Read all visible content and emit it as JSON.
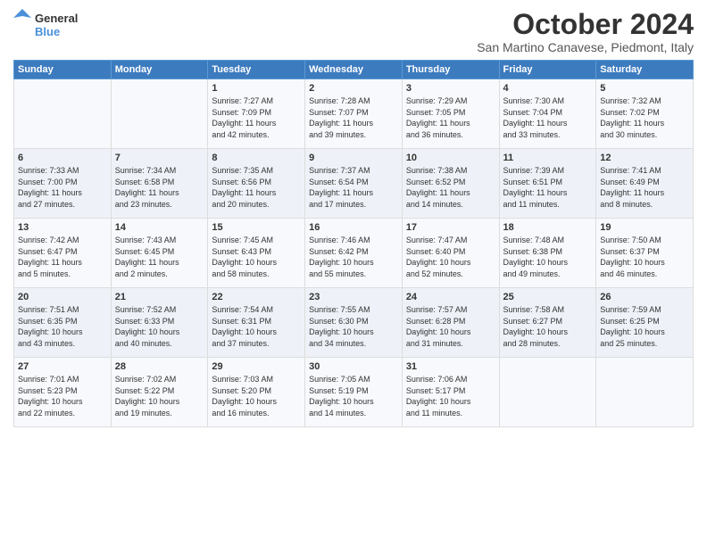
{
  "header": {
    "logo_line1": "General",
    "logo_line2": "Blue",
    "month": "October 2024",
    "location": "San Martino Canavese, Piedmont, Italy"
  },
  "days_of_week": [
    "Sunday",
    "Monday",
    "Tuesday",
    "Wednesday",
    "Thursday",
    "Friday",
    "Saturday"
  ],
  "weeks": [
    [
      {
        "day": "",
        "content": ""
      },
      {
        "day": "",
        "content": ""
      },
      {
        "day": "1",
        "content": "Sunrise: 7:27 AM\nSunset: 7:09 PM\nDaylight: 11 hours\nand 42 minutes."
      },
      {
        "day": "2",
        "content": "Sunrise: 7:28 AM\nSunset: 7:07 PM\nDaylight: 11 hours\nand 39 minutes."
      },
      {
        "day": "3",
        "content": "Sunrise: 7:29 AM\nSunset: 7:05 PM\nDaylight: 11 hours\nand 36 minutes."
      },
      {
        "day": "4",
        "content": "Sunrise: 7:30 AM\nSunset: 7:04 PM\nDaylight: 11 hours\nand 33 minutes."
      },
      {
        "day": "5",
        "content": "Sunrise: 7:32 AM\nSunset: 7:02 PM\nDaylight: 11 hours\nand 30 minutes."
      }
    ],
    [
      {
        "day": "6",
        "content": "Sunrise: 7:33 AM\nSunset: 7:00 PM\nDaylight: 11 hours\nand 27 minutes."
      },
      {
        "day": "7",
        "content": "Sunrise: 7:34 AM\nSunset: 6:58 PM\nDaylight: 11 hours\nand 23 minutes."
      },
      {
        "day": "8",
        "content": "Sunrise: 7:35 AM\nSunset: 6:56 PM\nDaylight: 11 hours\nand 20 minutes."
      },
      {
        "day": "9",
        "content": "Sunrise: 7:37 AM\nSunset: 6:54 PM\nDaylight: 11 hours\nand 17 minutes."
      },
      {
        "day": "10",
        "content": "Sunrise: 7:38 AM\nSunset: 6:52 PM\nDaylight: 11 hours\nand 14 minutes."
      },
      {
        "day": "11",
        "content": "Sunrise: 7:39 AM\nSunset: 6:51 PM\nDaylight: 11 hours\nand 11 minutes."
      },
      {
        "day": "12",
        "content": "Sunrise: 7:41 AM\nSunset: 6:49 PM\nDaylight: 11 hours\nand 8 minutes."
      }
    ],
    [
      {
        "day": "13",
        "content": "Sunrise: 7:42 AM\nSunset: 6:47 PM\nDaylight: 11 hours\nand 5 minutes."
      },
      {
        "day": "14",
        "content": "Sunrise: 7:43 AM\nSunset: 6:45 PM\nDaylight: 11 hours\nand 2 minutes."
      },
      {
        "day": "15",
        "content": "Sunrise: 7:45 AM\nSunset: 6:43 PM\nDaylight: 10 hours\nand 58 minutes."
      },
      {
        "day": "16",
        "content": "Sunrise: 7:46 AM\nSunset: 6:42 PM\nDaylight: 10 hours\nand 55 minutes."
      },
      {
        "day": "17",
        "content": "Sunrise: 7:47 AM\nSunset: 6:40 PM\nDaylight: 10 hours\nand 52 minutes."
      },
      {
        "day": "18",
        "content": "Sunrise: 7:48 AM\nSunset: 6:38 PM\nDaylight: 10 hours\nand 49 minutes."
      },
      {
        "day": "19",
        "content": "Sunrise: 7:50 AM\nSunset: 6:37 PM\nDaylight: 10 hours\nand 46 minutes."
      }
    ],
    [
      {
        "day": "20",
        "content": "Sunrise: 7:51 AM\nSunset: 6:35 PM\nDaylight: 10 hours\nand 43 minutes."
      },
      {
        "day": "21",
        "content": "Sunrise: 7:52 AM\nSunset: 6:33 PM\nDaylight: 10 hours\nand 40 minutes."
      },
      {
        "day": "22",
        "content": "Sunrise: 7:54 AM\nSunset: 6:31 PM\nDaylight: 10 hours\nand 37 minutes."
      },
      {
        "day": "23",
        "content": "Sunrise: 7:55 AM\nSunset: 6:30 PM\nDaylight: 10 hours\nand 34 minutes."
      },
      {
        "day": "24",
        "content": "Sunrise: 7:57 AM\nSunset: 6:28 PM\nDaylight: 10 hours\nand 31 minutes."
      },
      {
        "day": "25",
        "content": "Sunrise: 7:58 AM\nSunset: 6:27 PM\nDaylight: 10 hours\nand 28 minutes."
      },
      {
        "day": "26",
        "content": "Sunrise: 7:59 AM\nSunset: 6:25 PM\nDaylight: 10 hours\nand 25 minutes."
      }
    ],
    [
      {
        "day": "27",
        "content": "Sunrise: 7:01 AM\nSunset: 5:23 PM\nDaylight: 10 hours\nand 22 minutes."
      },
      {
        "day": "28",
        "content": "Sunrise: 7:02 AM\nSunset: 5:22 PM\nDaylight: 10 hours\nand 19 minutes."
      },
      {
        "day": "29",
        "content": "Sunrise: 7:03 AM\nSunset: 5:20 PM\nDaylight: 10 hours\nand 16 minutes."
      },
      {
        "day": "30",
        "content": "Sunrise: 7:05 AM\nSunset: 5:19 PM\nDaylight: 10 hours\nand 14 minutes."
      },
      {
        "day": "31",
        "content": "Sunrise: 7:06 AM\nSunset: 5:17 PM\nDaylight: 10 hours\nand 11 minutes."
      },
      {
        "day": "",
        "content": ""
      },
      {
        "day": "",
        "content": ""
      }
    ]
  ]
}
